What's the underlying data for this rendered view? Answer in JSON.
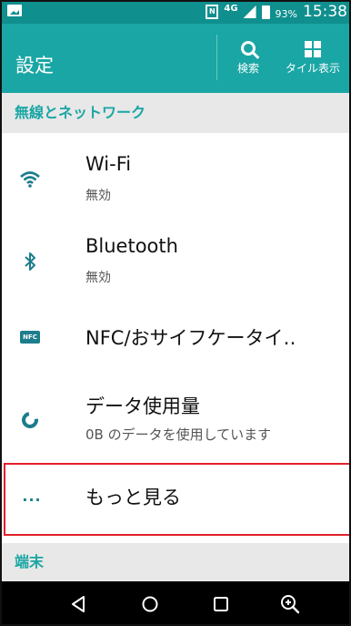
{
  "status_bar": {
    "network": "4G",
    "battery": "93%",
    "time": "15:38"
  },
  "header": {
    "title": "設定",
    "actions": [
      {
        "label": "検索",
        "icon": "search-icon"
      },
      {
        "label": "タイル表示",
        "icon": "tile-view-icon"
      }
    ]
  },
  "sections": [
    {
      "title": "無線とネットワーク",
      "items": [
        {
          "title": "Wi-Fi",
          "subtitle": "無効",
          "icon": "wifi-icon"
        },
        {
          "title": "Bluetooth",
          "subtitle": "無効",
          "icon": "bluetooth-icon"
        },
        {
          "title": "NFC/おサイフケータイ‥",
          "icon": "nfc-icon",
          "icon_text": "NFC"
        },
        {
          "title": "データ使用量",
          "subtitle": "0B のデータを使用しています",
          "icon": "data-usage-icon"
        },
        {
          "title": "もっと見る",
          "icon": "more-icon",
          "icon_text": "···",
          "highlighted": true,
          "highlight_color": "#e3212b"
        }
      ]
    },
    {
      "title": "端末",
      "items": []
    }
  ],
  "nav_bar": {
    "buttons": [
      "back-icon",
      "home-icon",
      "recent-apps-icon",
      "zoom-icon"
    ]
  },
  "colors": {
    "status_bar": "#0f8f8e",
    "action_bar": "#1aa6a4",
    "accent": "#1aa6a4",
    "icon": "#1c7d8c",
    "section_bg": "#e8e8e8"
  }
}
